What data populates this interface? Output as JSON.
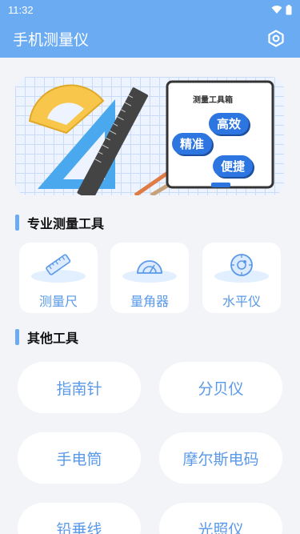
{
  "status_bar": {
    "time": "11:32",
    "wifi_icon": "wifi-icon",
    "battery_icon": "battery-icon"
  },
  "app_bar": {
    "title": "手机测量仪",
    "settings_icon": "gear-hexagon-icon"
  },
  "banner": {
    "board_title": "测量工具箱",
    "bubbles": [
      "高效",
      "精准",
      "便捷"
    ]
  },
  "sections": {
    "professional": "专业测量工具",
    "other": "其他工具"
  },
  "pro_tools": [
    {
      "label": "测量尺",
      "icon": "ruler-icon"
    },
    {
      "label": "量角器",
      "icon": "protractor-icon"
    },
    {
      "label": "水平仪",
      "icon": "level-icon"
    }
  ],
  "other_tools": [
    {
      "label": "指南针"
    },
    {
      "label": "分贝仪"
    },
    {
      "label": "手电筒"
    },
    {
      "label": "摩尔斯电码"
    },
    {
      "label": "铅垂线"
    },
    {
      "label": "光照仪"
    }
  ],
  "colors": {
    "accent": "#6aabf2",
    "label": "#5a99e8",
    "background": "#f2f4f8"
  }
}
